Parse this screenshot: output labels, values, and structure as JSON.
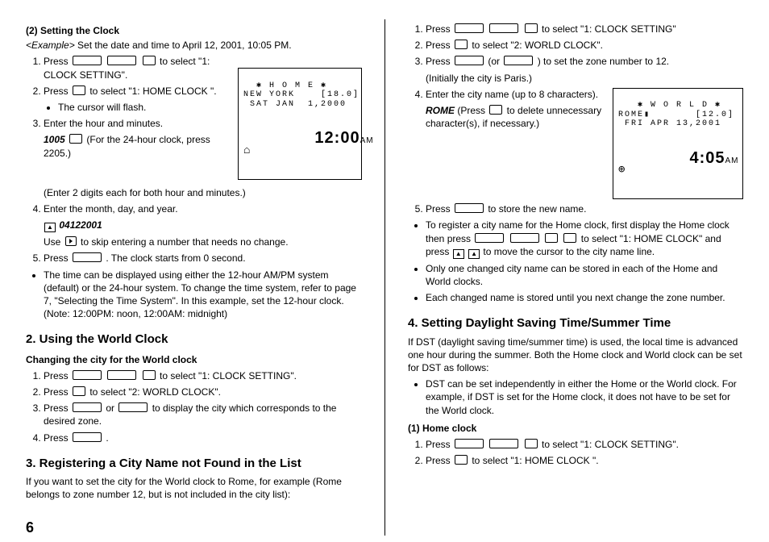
{
  "left": {
    "h_setting_clock": "(2) Setting the Clock",
    "example_prefix": "<Example>",
    "example_text": " Set the date and time to April 12, 2001, 10:05 PM.",
    "step1_prefix": "Press ",
    "step1_suffix": " to select \"1: CLOCK SETTING\".",
    "step2_prefix": "Press ",
    "step2_suffix": " to select \"1: HOME CLOCK \".",
    "bullet_cursor": "The cursor will flash.",
    "step3": "Enter the hour and minutes.",
    "s3_code": "1005",
    "s3_after_key": "   (For the 24-hour clock, press 2205.)",
    "s3_note": "(Enter 2 digits each for both hour and minutes.)",
    "step4": "Enter the month, day, and year.",
    "s4_code": "04122001",
    "s4_use": "Use ",
    "s4_use2": " to skip entering a number that needs no change.",
    "step5_prefix": "Press ",
    "step5_suffix": " . The clock starts from 0 second.",
    "bullet_time": "The time can be displayed using either the 12-hour AM/PM system (default) or the 24-hour system. To change the time system, refer to page 7, \"Selecting the Time System\". In this example, set the 12-hour clock. (Note: 12:00PM: noon, 12:00AM: midnight)",
    "h_world": "2. Using the World Clock",
    "h_changing": "Changing the city for the World clock",
    "w_step1_prefix": "Press ",
    "w_step1_suffix": " to select \"1: CLOCK SETTING\".",
    "w_step2_prefix": "Press ",
    "w_step2_suffix": " to select \"2: WORLD CLOCK\".",
    "w_step3_prefix": "Press ",
    "w_step3_or": " or ",
    "w_step3_suffix": " to display the city which corresponds to the desired zone.",
    "w_step4_prefix": "Press ",
    "w_step4_suffix": " .",
    "h_register": "3. Registering a City Name not Found in the List",
    "register_intro": "If you want to set the city for the World clock to Rome, for example (Rome belongs to zone number 12, but is not included in the city list):",
    "lcd1_l1": "  ✱ H O M E ✱",
    "lcd1_l2": "NEW YORK    [18.0]",
    "lcd1_l3": " SAT JAN  1,2000",
    "lcd1_icon": "⌂",
    "lcd1_time": "12:00",
    "lcd1_ampm": "AM"
  },
  "right": {
    "r_step1_prefix": "Press ",
    "r_step1_suffix": " to select \"1: CLOCK SETTING\"",
    "r_step2_prefix": "Press ",
    "r_step2_suffix": " to select \"2: WORLD CLOCK\".",
    "r_step3_prefix": "Press ",
    "r_step3_or_open": " (or ",
    "r_step3_or_close": " ) to set the zone number to 12.",
    "r_step3_note": "(Initially the city is Paris.)",
    "r_step4": "Enter the city name (up to 8 characters).",
    "r_step4_rome": "ROME",
    "r_step4_press": " (Press ",
    "r_step4_del": " to delete unnecessary character(s), if necessary.)",
    "r_step5_prefix": "Press ",
    "r_step5_suffix": " to store the new name.",
    "r_bullet_register_a": "To register a city name for the Home clock, first display the Home clock then press ",
    "r_bullet_register_b": " to select \"1: HOME CLOCK\" and press ",
    "r_bullet_register_c": " to move the cursor to the city name line.",
    "r_bullet_one": "Only one changed city name can be stored in each of the Home and World clocks.",
    "r_bullet_each": "Each changed name is stored until you next change the zone number.",
    "h_dst": "4. Setting Daylight Saving Time/Summer Time",
    "dst_intro": "If DST (daylight saving time/summer time) is used, the local time is advanced one hour during the summer. Both the Home clock and World clock can be set for DST as follows:",
    "dst_bullet": "DST can be set  independently in either the Home or the World clock. For example, if DST is set for the Home clock, it  does not  have to be set for the World clock.",
    "h_home_clock": "(1) Home clock",
    "hc_step1_prefix": "Press ",
    "hc_step1_suffix": " to select \"1: CLOCK SETTING\".",
    "hc_step2_prefix": "Press ",
    "hc_step2_suffix": " to select \"1: HOME CLOCK \".",
    "lcd2_l1": "   ✱ W O R L D ✱",
    "lcd2_l2": "ROME▮       [12.0]",
    "lcd2_l3": " FRI APR 13,2001",
    "lcd2_icon": "⊕",
    "lcd2_time": "4:05",
    "lcd2_ampm": "AM"
  },
  "pagenum": "6"
}
